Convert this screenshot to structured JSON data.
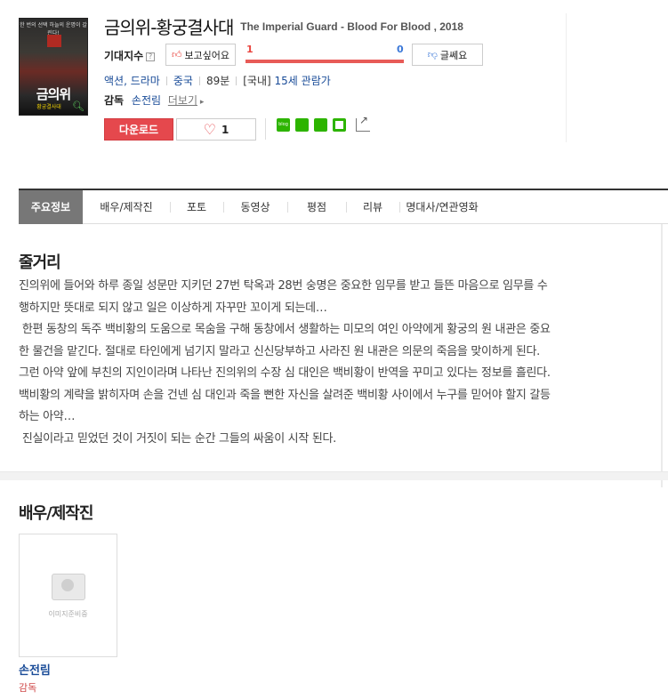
{
  "movie": {
    "title_ko": "금의위-황궁결사대",
    "title_en": "The Imperial Guard - Blood For Blood , 2018",
    "expect_label": "기대지수",
    "want_label": "보고싶어요",
    "want_count": "1",
    "dislike_count": "0",
    "dislike_label": "글쎄요",
    "genre": "액션, 드라마",
    "country": "중국",
    "runtime": "89분",
    "rating_prefix": "[국내]",
    "rating": "15세 관람가",
    "director_label": "감독",
    "director_name": "손전림",
    "more_label": "더보기",
    "download_label": "다운로드",
    "like_count": "1",
    "poster": {
      "top_text": "한 번의 선택 하늘의 운명이 갈린다!",
      "title": "금의위",
      "subtitle": "황궁결사대"
    }
  },
  "tabs": [
    "주요정보",
    "배우/제작진",
    "포토",
    "동영상",
    "평점",
    "리뷰",
    "명대사/연관영화"
  ],
  "synopsis": {
    "title": "줄거리",
    "lines": [
      "진의위에 들어와 하루 종일 성문만 지키던 27번 탁옥과 28번 숭명은 중요한 임무를 받고 들뜬 마음으로 임무를 수",
      "행하지만 뜻대로 되지 않고 일은 이상하게 자꾸만 꼬이게 되는데…",
      " 한편 동창의 독주 백비황의 도움으로 목숨을 구해 동창에서 생활하는 미모의 여인 아약에게 황궁의 원 내관은 중요",
      "한 물건을 맡긴다. 절대로 타인에게 넘기지 말라고 신신당부하고 사라진 원 내관은 의문의 죽음을 맞이하게 된다.",
      "그런 아약 앞에 부친의 지인이라며 나타난 진의위의 수장 심 대인은 백비황이 반역을 꾸미고 있다는 정보를 흘린다.",
      "백비황의 계략을 밝히자며 손을 건넨 심 대인과 죽을 뻔한 자신을 살려준 백비황 사이에서 누구를 믿어야 할지 갈등",
      "하는 아약…",
      " 진실이라고 믿었던 것이 거짓이 되는 순간 그들의 싸움이 시작 된다."
    ]
  },
  "cast": {
    "title": "배우/제작진",
    "placeholder_text": "이미지준비중",
    "people": [
      {
        "name": "손전림",
        "role": "감독"
      }
    ]
  }
}
